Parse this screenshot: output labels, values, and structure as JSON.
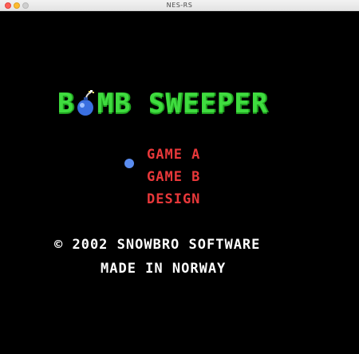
{
  "window": {
    "title": "NES-RS"
  },
  "game": {
    "logo": {
      "part1": "B",
      "part2": "MB SWEEPER"
    },
    "menu": [
      {
        "label": "GAME A",
        "selected": true
      },
      {
        "label": "GAME B",
        "selected": false
      },
      {
        "label": "DESIGN",
        "selected": false
      }
    ],
    "credits": {
      "line1": "© 2002 SNOWBRO SOFTWARE",
      "line2": "MADE IN NORWAY"
    }
  },
  "colors": {
    "background": "#000000",
    "logo": "#3fdc3f",
    "menu": "#e8383a",
    "selector": "#5a8cf0",
    "credits": "#ffffff"
  },
  "icons": {
    "bomb": "bomb-icon",
    "selector": "selector-dot-icon"
  }
}
